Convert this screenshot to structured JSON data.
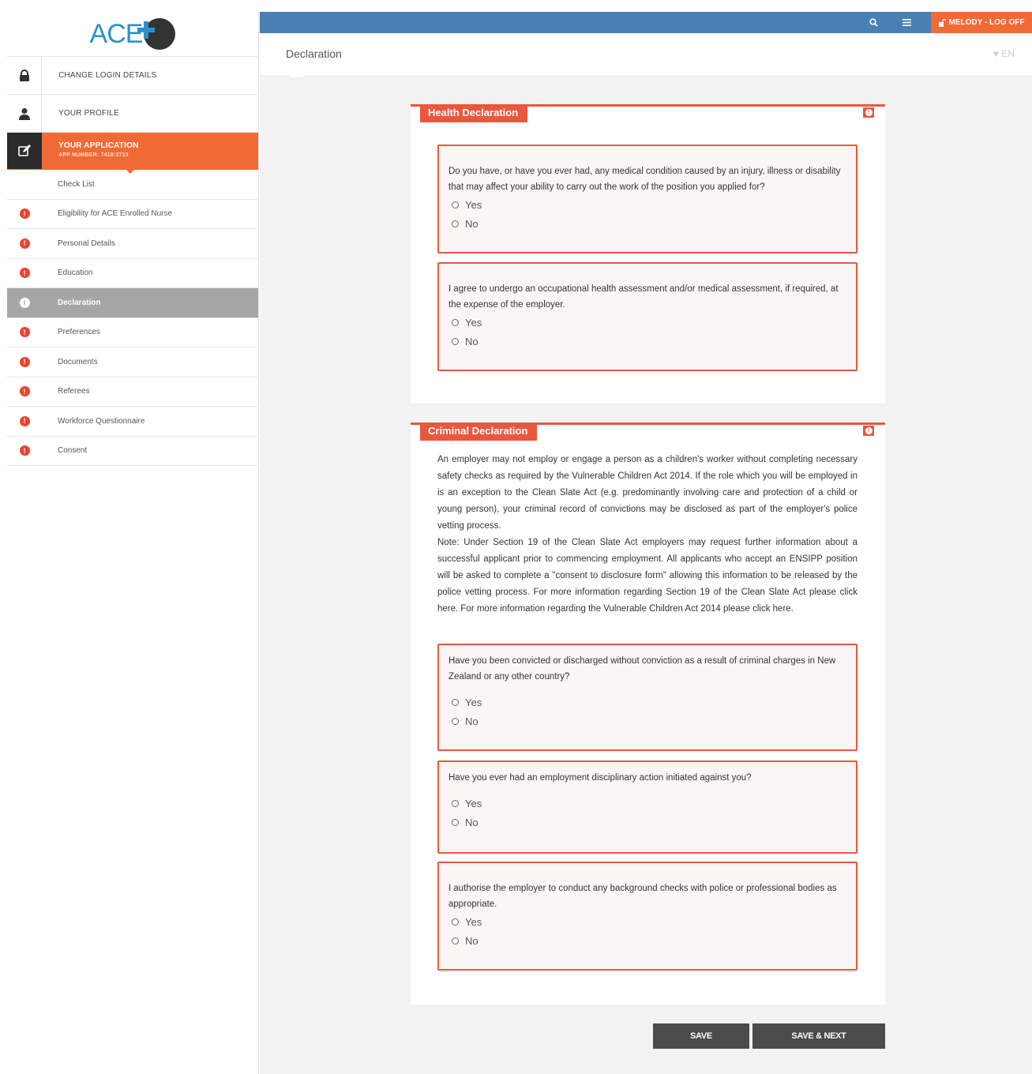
{
  "app": {
    "logo_text": "ACE"
  },
  "sidebar": {
    "main_items": [
      {
        "label": "CHANGE LOGIN DETAILS",
        "icon": "lock-icon"
      },
      {
        "label": "YOUR PROFILE",
        "icon": "user-icon"
      },
      {
        "label": "YOUR APPLICATION",
        "sub": "APP NUMBER: 7418:3713",
        "icon": "edit-icon"
      }
    ],
    "sub_items": [
      {
        "label": "Check List",
        "status": "none"
      },
      {
        "label": "Eligibility for ACE Enrolled Nurse",
        "status": "warning"
      },
      {
        "label": "Personal Details",
        "status": "warning"
      },
      {
        "label": "Education",
        "status": "warning"
      },
      {
        "label": "Declaration",
        "status": "selected"
      },
      {
        "label": "Preferences",
        "status": "warning"
      },
      {
        "label": "Documents",
        "status": "warning"
      },
      {
        "label": "Referees",
        "status": "warning"
      },
      {
        "label": "Workforce Questionnaire",
        "status": "warning"
      },
      {
        "label": "Consent",
        "status": "warning"
      }
    ]
  },
  "topbar": {
    "logoff_label": "MELODY - LOG OFF",
    "accent": "#f06a36",
    "bar_color": "#4a7fb3"
  },
  "header": {
    "title": "Declaration",
    "lang": "EN"
  },
  "health": {
    "title": "Health Declaration",
    "questions": [
      {
        "text": "Do you have, or have you ever had, any medical condition caused by an injury, illness or disability that may affect your ability to carry out the work of the position you applied for?",
        "options": [
          "Yes",
          "No"
        ]
      },
      {
        "text": "I agree to undergo an occupational health assessment and/or medical assessment, if required, at the expense of the employer.",
        "options": [
          "Yes",
          "No"
        ]
      }
    ]
  },
  "criminal": {
    "title": "Criminal Declaration",
    "intro": "An employer may not employ or engage a person as a children's worker without completing necessary safety checks as required by the Vulnerable Children Act 2014. If the role which you will be employed in is an exception to the Clean Slate Act (e.g. predominantly involving care and protection of a child or young person), your criminal record of convictions may be disclosed as part of the employer's police vetting process.",
    "note": "Note: Under Section 19 of the Clean Slate Act employers may request further information about a successful applicant prior to commencing employment. All applicants who accept an ENSIPP position will be asked to complete a \"consent to disclosure form\" allowing this information to be released by the police vetting process. For more information regarding Section 19 of the Clean Slate Act please click here. For more information regarding the Vulnerable Children Act 2014 please click here.",
    "questions": [
      {
        "text": "Have you been convicted or discharged without conviction as a result of criminal charges in New Zealand or any other country?",
        "options": [
          "Yes",
          "No"
        ]
      },
      {
        "text": "Have you ever had an employment disciplinary action initiated against you?",
        "options": [
          "Yes",
          "No"
        ]
      },
      {
        "text": "I authorise the employer to conduct any background checks with police or professional bodies as appropriate.",
        "options": [
          "Yes",
          "No"
        ]
      }
    ]
  },
  "actions": {
    "save_label": "SAVE",
    "save_next_label": "SAVE & NEXT"
  }
}
